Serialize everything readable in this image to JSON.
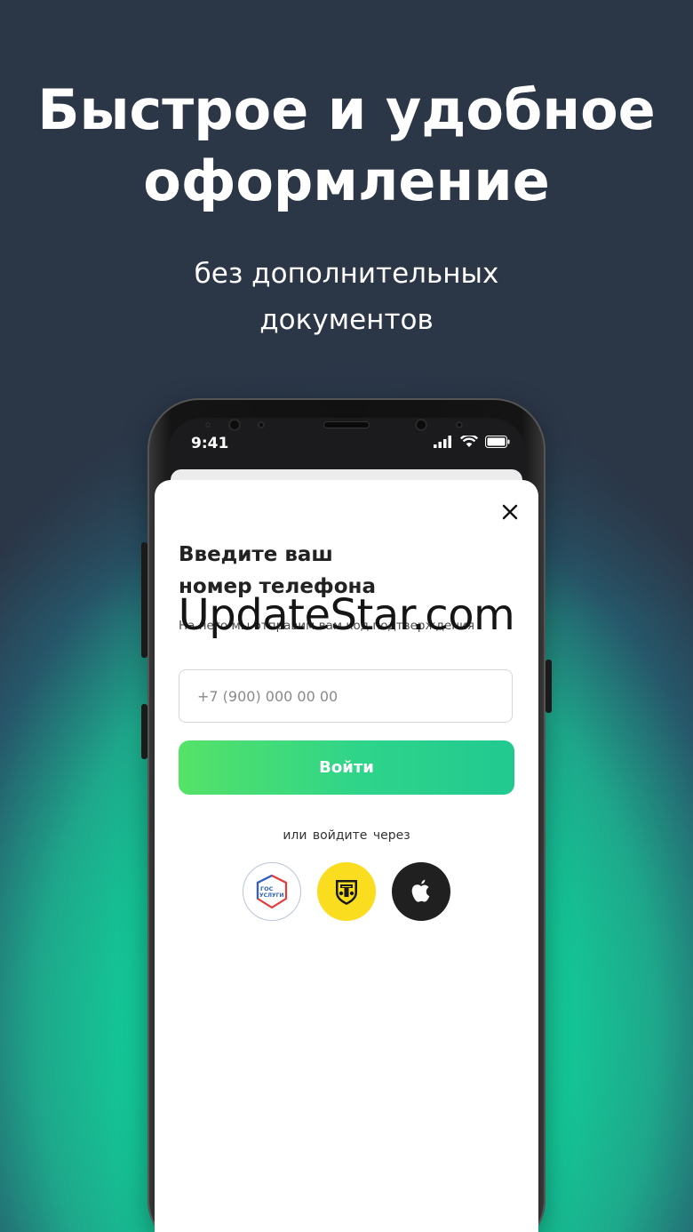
{
  "promo": {
    "headline_line1": "Быстрое и удобное",
    "headline_line2": "оформление",
    "subhead_line1": "без дополнительных",
    "subhead_line2": "документов"
  },
  "status_bar": {
    "time": "9:41"
  },
  "modal": {
    "title_line1": "Введите ваш",
    "title_line2": "номер телефона",
    "subtitle": "На него мы отправим вам код подтверждения",
    "phone_placeholder": "+7 (900) 000 00 00",
    "login_label": "Войти",
    "or_text": "или  войдите через",
    "gos_logo_line1": "ГОС",
    "gos_logo_line2": "УСЛУГИ"
  },
  "watermark": "UpdateStar.com",
  "colors": {
    "dark_bg": "#2b3647",
    "accent_green": "#14c596",
    "button_gradient_start": "#55e268",
    "button_gradient_end": "#21c991",
    "tinkoff_yellow": "#fadd1f",
    "apple_black": "#202020"
  },
  "icons": [
    "close-icon",
    "gosuslugi-icon",
    "tinkoff-icon",
    "apple-icon",
    "signal-icon",
    "wifi-icon",
    "battery-icon"
  ]
}
